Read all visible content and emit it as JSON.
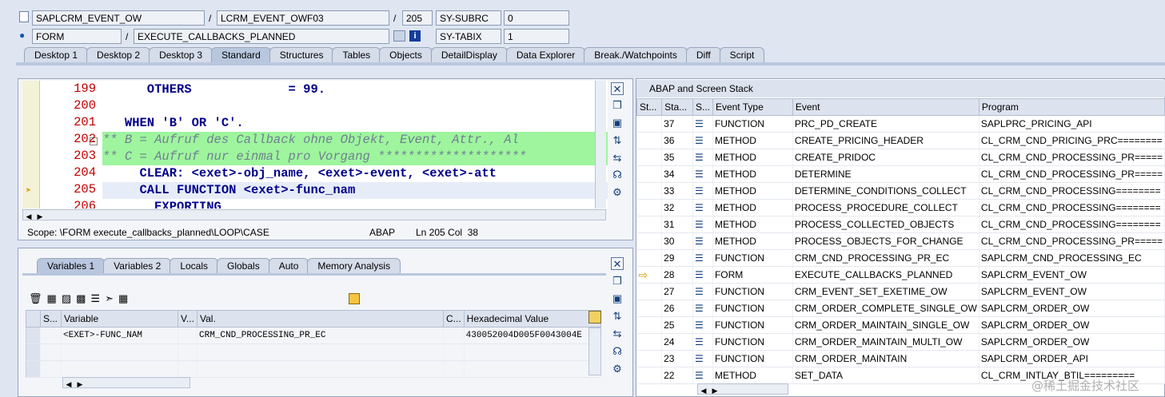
{
  "header": {
    "row1": {
      "program": "SAPLCRM_EVENT_OW",
      "include": "LCRM_EVENT_OWF03",
      "line": "205",
      "sysvar_name": "SY-SUBRC",
      "sysvar_value": "0"
    },
    "row2": {
      "type": "FORM",
      "name": "EXECUTE_CALLBACKS_PLANNED",
      "sysvar_name": "SY-TABIX",
      "sysvar_value": "1"
    },
    "slash": "/"
  },
  "tabs": [
    {
      "label": "Desktop 1"
    },
    {
      "label": "Desktop 2"
    },
    {
      "label": "Desktop 3"
    },
    {
      "label": "Standard",
      "active": true
    },
    {
      "label": "Structures"
    },
    {
      "label": "Tables"
    },
    {
      "label": "Objects"
    },
    {
      "label": "DetailDisplay"
    },
    {
      "label": "Data Explorer"
    },
    {
      "label": "Break./Watchpoints"
    },
    {
      "label": "Diff"
    },
    {
      "label": "Script"
    }
  ],
  "code": {
    "lines": [
      {
        "num": "199",
        "text": "      OTHERS             = 99."
      },
      {
        "num": "200",
        "text": ""
      },
      {
        "num": "201",
        "text": "   WHEN 'B' OR 'C'."
      },
      {
        "num": "202",
        "text": "** B = Aufruf des Callback ohne Objekt, Event, Attr., Al"
      },
      {
        "num": "203",
        "text": "** C = Aufruf nur einmal pro Vorgang ********************"
      },
      {
        "num": "204",
        "text": "     CLEAR: <exet>-obj_name, <exet>-event, <exet>-att"
      },
      {
        "num": "205",
        "text": "     CALL FUNCTION <exet>-func_nam"
      },
      {
        "num": "206",
        "text": "       EXPORTING"
      }
    ],
    "scope": "Scope: \\FORM execute_callbacks_planned\\LOOP\\CASE",
    "lang": "ABAP",
    "position": "Ln 205 Col  38"
  },
  "vartabs": [
    {
      "label": "Variables 1",
      "active": true
    },
    {
      "label": "Variables 2"
    },
    {
      "label": "Locals"
    },
    {
      "label": "Globals"
    },
    {
      "label": "Auto"
    },
    {
      "label": "Memory Analysis"
    }
  ],
  "vartable": {
    "headers": [
      "S...",
      "Variable",
      "V...",
      "Val.",
      "C...",
      "Hexadecimal Value"
    ],
    "rows": [
      {
        "variable": "<EXET>-FUNC_NAM",
        "value": "CRM_CND_PROCESSING_PR_EC",
        "hex": "430052004D005F0043004E"
      }
    ]
  },
  "stack": {
    "title": "ABAP and Screen Stack",
    "headers": [
      "St...",
      "Sta...",
      "S...",
      "Event Type",
      "Event",
      "Program"
    ],
    "rows": [
      {
        "level": "37",
        "type": "FUNCTION",
        "event": "PRC_PD_CREATE",
        "program": "SAPLPRC_PRICING_API"
      },
      {
        "level": "36",
        "type": "METHOD",
        "event": "CREATE_PRICING_HEADER",
        "program": "CL_CRM_CND_PRICING_PRC========"
      },
      {
        "level": "35",
        "type": "METHOD",
        "event": "CREATE_PRIDOC",
        "program": "CL_CRM_CND_PROCESSING_PR====="
      },
      {
        "level": "34",
        "type": "METHOD",
        "event": "DETERMINE",
        "program": "CL_CRM_CND_PROCESSING_PR====="
      },
      {
        "level": "33",
        "type": "METHOD",
        "event": "DETERMINE_CONDITIONS_COLLECT",
        "program": "CL_CRM_CND_PROCESSING========"
      },
      {
        "level": "32",
        "type": "METHOD",
        "event": "PROCESS_PROCEDURE_COLLECT",
        "program": "CL_CRM_CND_PROCESSING========"
      },
      {
        "level": "31",
        "type": "METHOD",
        "event": "PROCESS_COLLECTED_OBJECTS",
        "program": "CL_CRM_CND_PROCESSING========"
      },
      {
        "level": "30",
        "type": "METHOD",
        "event": "PROCESS_OBJECTS_FOR_CHANGE",
        "program": "CL_CRM_CND_PROCESSING_PR====="
      },
      {
        "level": "29",
        "type": "FUNCTION",
        "event": "CRM_CND_PROCESSING_PR_EC",
        "program": "SAPLCRM_CND_PROCESSING_EC"
      },
      {
        "level": "28",
        "type": "FORM",
        "event": "EXECUTE_CALLBACKS_PLANNED",
        "program": "SAPLCRM_EVENT_OW",
        "current": true
      },
      {
        "level": "27",
        "type": "FUNCTION",
        "event": "CRM_EVENT_SET_EXETIME_OW",
        "program": "SAPLCRM_EVENT_OW"
      },
      {
        "level": "26",
        "type": "FUNCTION",
        "event": "CRM_ORDER_COMPLETE_SINGLE_OW",
        "program": "SAPLCRM_ORDER_OW"
      },
      {
        "level": "25",
        "type": "FUNCTION",
        "event": "CRM_ORDER_MAINTAIN_SINGLE_OW",
        "program": "SAPLCRM_ORDER_OW"
      },
      {
        "level": "24",
        "type": "FUNCTION",
        "event": "CRM_ORDER_MAINTAIN_MULTI_OW",
        "program": "SAPLCRM_ORDER_OW"
      },
      {
        "level": "23",
        "type": "FUNCTION",
        "event": "CRM_ORDER_MAINTAIN",
        "program": "SAPLCRM_ORDER_API"
      },
      {
        "level": "22",
        "type": "METHOD",
        "event": "SET_DATA",
        "program": "CL_CRM_INTLAY_BTIL========="
      }
    ]
  },
  "watermark": "@稀土掘金技术社区",
  "colors": {
    "accent": "#b9c7de",
    "line_number": "#c00000",
    "keyword": "#00008b",
    "comment_bg": "#9ef59e"
  }
}
